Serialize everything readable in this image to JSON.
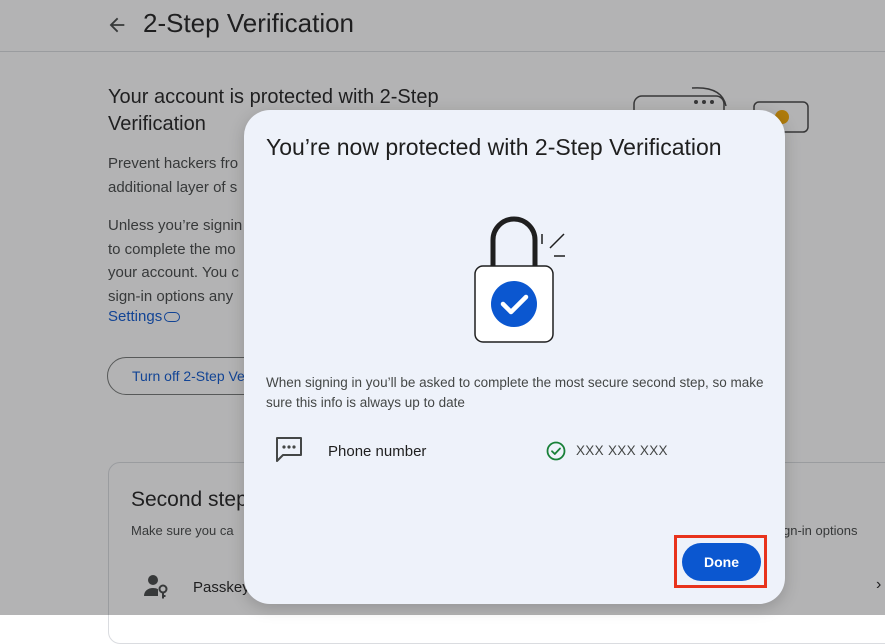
{
  "header": {
    "title": "2-Step Verification"
  },
  "protection": {
    "title": "Your account is protected with 2-Step Verification",
    "para1_line1": "Prevent hackers fro",
    "para1_line2": "additional layer of s",
    "para2_line1": "Unless you’re signin",
    "para2_line2": "to complete the mo",
    "para2_line3": "your account. You c",
    "para2_line4": "sign-in options any",
    "settings_link": "Settings",
    "turn_off_button": "Turn off 2-Step Ve"
  },
  "second_steps": {
    "title": "Second step",
    "description": "Make sure you ca",
    "description_right": "gn-in options",
    "passkey_label": "Passkey"
  },
  "dialog": {
    "title": "You’re now protected with 2-Step Verification",
    "description": "When signing in you’ll be asked to complete the most secure second step, so make sure this info is always up to date",
    "phone_label": "Phone number",
    "phone_value": "XXX XXX XXX",
    "done_button": "Done"
  },
  "icons": {
    "back": "arrow-left-icon",
    "link": "link-icon",
    "lock": "lock-check-illustration",
    "message": "message-dots-icon",
    "verified": "check-circle-icon",
    "passkey": "person-key-icon",
    "chevron": "chevron-right-icon"
  },
  "colors": {
    "accent": "#0b57d0",
    "dialog_bg": "#eef2fa",
    "success": "#188038",
    "highlight": "#e8331c"
  }
}
